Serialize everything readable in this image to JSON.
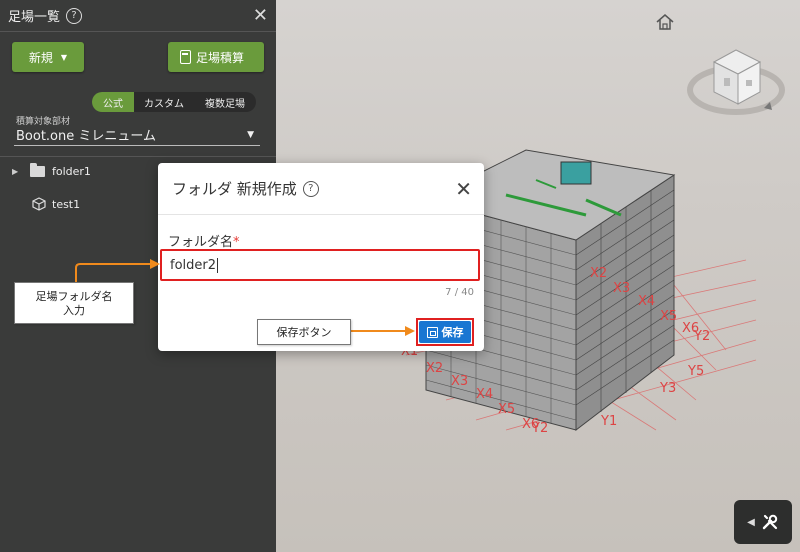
{
  "sidebar": {
    "title": "足場一覧",
    "new_button": "新規",
    "calc_button": "足場積算",
    "segments": [
      "公式",
      "カスタム",
      "複数足場"
    ],
    "active_segment": "公式",
    "target_label": "積算対象部材",
    "target_value": "Boot.one ミレニューム",
    "tree": [
      {
        "label": "folder1",
        "type": "folder"
      },
      {
        "label": "test1",
        "type": "model"
      }
    ]
  },
  "dialog": {
    "title": "フォルダ 新規作成",
    "field_label": "フォルダ名",
    "required_mark": "*",
    "input_value": "folder2",
    "char_count": "7 / 40",
    "save_label": "保存"
  },
  "callouts": {
    "folder_line1": "足場フォルダ名",
    "folder_line2": "入力",
    "save": "保存ボタン"
  },
  "viewport": {
    "grid_labels": [
      "X1",
      "X2",
      "X3",
      "X4",
      "X5",
      "X6",
      "X2",
      "X3",
      "X4",
      "X5",
      "X6",
      "Y1",
      "Y2",
      "Y3",
      "Y5",
      "Y2",
      "Y3",
      "Y1",
      "X2"
    ]
  },
  "colors": {
    "accent_green": "#6a9b3c",
    "primary_blue": "#1976d2",
    "highlight_red": "#e02020",
    "arrow_orange": "#f08a1c",
    "sidebar_bg": "#3a3b3a"
  }
}
